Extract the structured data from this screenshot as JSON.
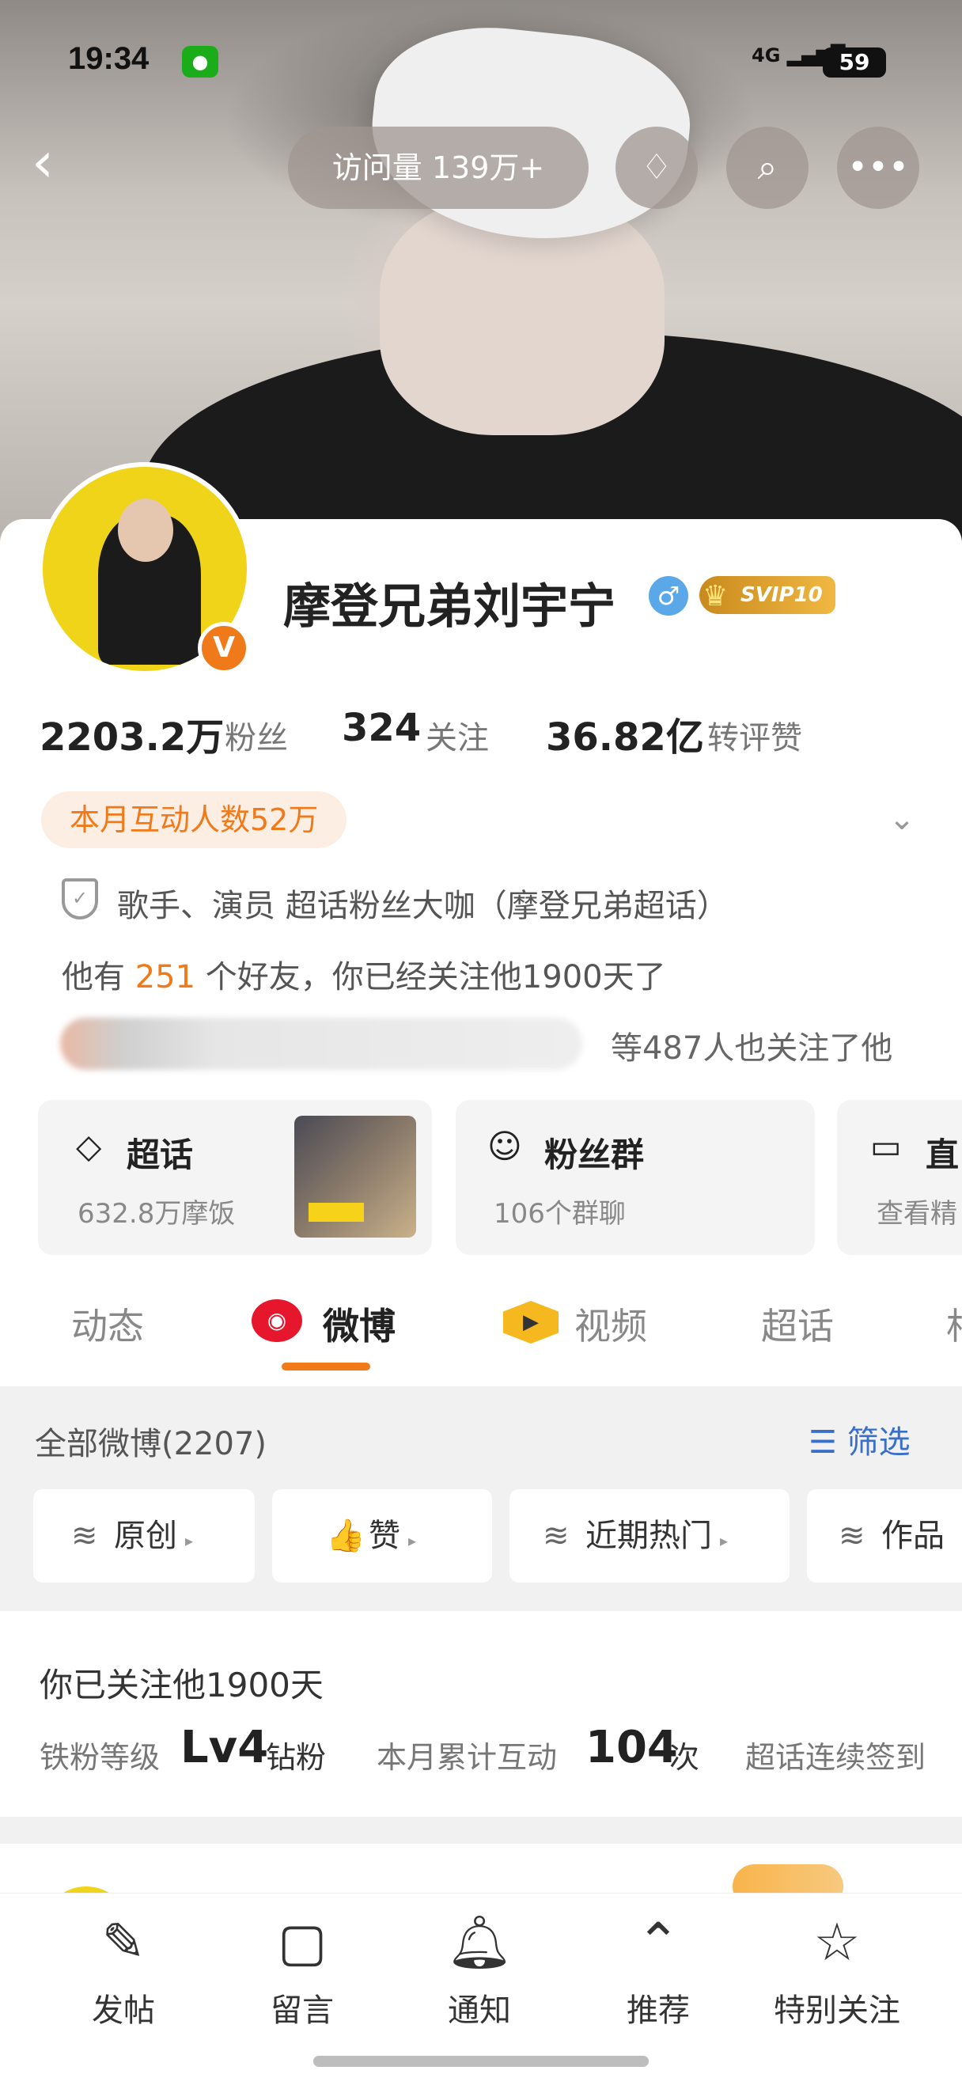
{
  "status_bar": {
    "time": "19:34",
    "network": "4G",
    "battery": "59"
  },
  "header": {
    "visits_label": "访问量 139万+"
  },
  "profile": {
    "name": "摩登兄弟刘宇宁",
    "gender_symbol": "♂",
    "vip_label": "SVIP10",
    "stats": [
      {
        "value": "2203.2万",
        "label": "粉丝"
      },
      {
        "value": "324",
        "label": "关注"
      },
      {
        "value": "36.82亿",
        "label": "转评赞"
      }
    ],
    "interaction_badge": "本月互动人数52万",
    "auth": "歌手、演员 超话粉丝大咖（摩登兄弟超话）",
    "friends_prefix": "他有 ",
    "friends_count": "251",
    "friends_suffix": " 个好友，你已经关注他1900天了",
    "also_follow": "等487人也关注了他"
  },
  "tiles": [
    {
      "title": "超话",
      "subtitle": "632.8万摩饭"
    },
    {
      "title": "粉丝群",
      "subtitle": "106个群聊"
    },
    {
      "title": "直",
      "subtitle": "查看精"
    }
  ],
  "tabs": [
    "动态",
    "微博",
    "视频",
    "超话",
    "相"
  ],
  "feed": {
    "all_label": "全部微博(2207)",
    "filter_label": "筛选",
    "chips": [
      "原创",
      "赞",
      "近期热门",
      "作品"
    ]
  },
  "follow_info": {
    "title": "你已关注他1900天",
    "level_label": "铁粉等级",
    "level_value": "Lv4",
    "level_unit": "钻粉",
    "month_label": "本月累计互动",
    "month_value": "104",
    "month_unit": "次",
    "checkin_label": "超话连续签到"
  },
  "bottom_nav": [
    {
      "label": "发帖",
      "icon": "pencil-icon"
    },
    {
      "label": "留言",
      "icon": "message-icon"
    },
    {
      "label": "通知",
      "icon": "bell-icon"
    },
    {
      "label": "推荐",
      "icon": "chevron-up-circle-icon"
    },
    {
      "label": "特别关注",
      "icon": "user-star-icon"
    }
  ],
  "colors": {
    "accent": "#f07a1a",
    "link": "#3a6fc9",
    "weibo_red": "#e6162d"
  }
}
